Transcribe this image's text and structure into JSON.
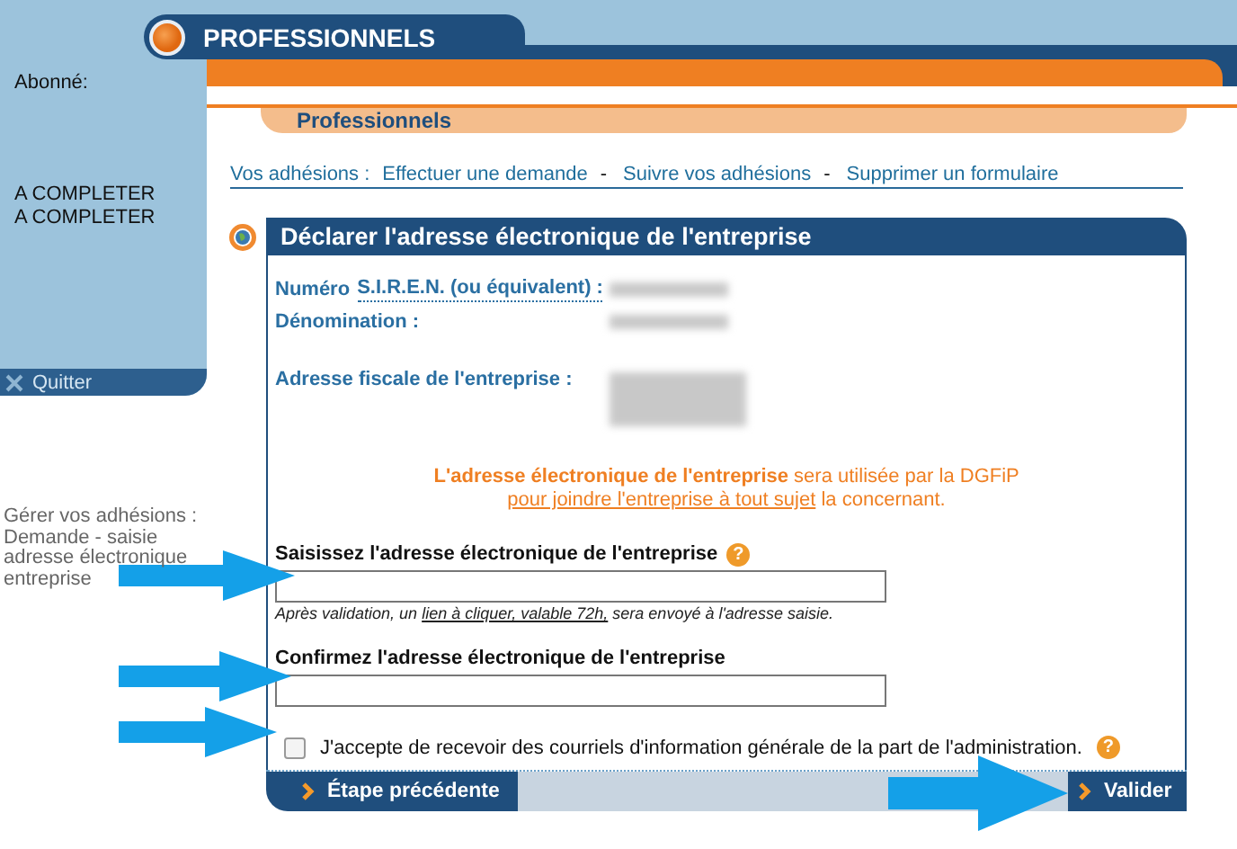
{
  "header": {
    "title": "PROFESSIONNELS"
  },
  "sidebar": {
    "lines": [
      "Abonné:",
      "A COMPLETER",
      "A COMPLETER"
    ],
    "quit": "Quitter"
  },
  "help_text": "Gérer vos adhésions : Demande - saisie adresse électronique entreprise",
  "section_tab": "Professionnels",
  "nav": {
    "label": "Vos adhésions :",
    "items": [
      {
        "kind": "link",
        "text": "Effectuer une demande"
      },
      {
        "kind": "separator",
        "text": "-"
      },
      {
        "kind": "link",
        "text": "Suivre vos adhésions"
      },
      {
        "kind": "separator",
        "text": "-"
      },
      {
        "kind": "link",
        "text": "Supprimer un formulaire"
      }
    ]
  },
  "panel": {
    "title": "Déclarer l'adresse électronique de l'entreprise",
    "info": [
      {
        "label": "Numéro",
        "abbr": "S.I.R.E.N. (ou équivalent) :"
      },
      {
        "label": "Dénomination :"
      },
      {
        "label": "Adresse fiscale de l'entreprise :"
      }
    ],
    "notice": [
      {
        "kind": "text",
        "text": "**L'adresse électronique de l'entreprise** sera utilisée par la DGFiP"
      },
      {
        "kind": "link",
        "text": "pour joindre l'entreprise à tout sujet"
      },
      {
        "kind": "text",
        "text": "la concernant."
      }
    ],
    "email": {
      "label": "Saisissez l'adresse électronique de l'entreprise",
      "help": "?",
      "hint": [
        {
          "kind": "text",
          "text": "Après validation, un"
        },
        {
          "kind": "link",
          "text": "lien à cliquer, valable 72h,"
        },
        {
          "kind": "text",
          "text": "sera envoyé à l'adresse saisie."
        }
      ]
    },
    "confirm": {
      "label": "Confirmez l'adresse électronique de l'entreprise"
    },
    "consent": {
      "label": "J'accepte de recevoir des courriels d'information générale de la part de l'administration.",
      "checked": false,
      "help": "?"
    },
    "buttons": {
      "previous": "Étape précédente",
      "submit": "Valider"
    }
  }
}
